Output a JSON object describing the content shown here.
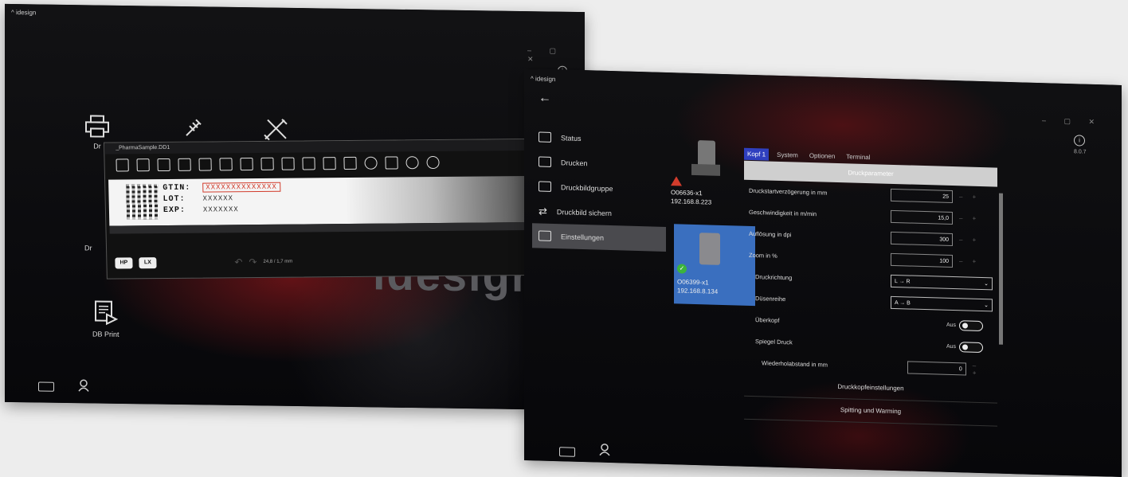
{
  "left_window": {
    "app_title": "idesign",
    "tiles": [
      {
        "label": "Dr",
        "icon": "printer-icon"
      },
      {
        "label": "",
        "icon": "plug-icon"
      },
      {
        "label": "",
        "icon": "tools-icon"
      },
      {
        "label": "Dr",
        "icon": "document-icon"
      },
      {
        "label": "DB Print",
        "icon": "db-print-icon"
      }
    ],
    "background_logo": "idesign",
    "editor": {
      "title": "_PharmaSample.DD1",
      "label_lines": [
        {
          "key": "GTIN:",
          "value": "XXXXXXXXXXXXXX"
        },
        {
          "key": "LOT:",
          "value": "XXXXXX"
        },
        {
          "key": "EXP:",
          "value": "XXXXXXX"
        }
      ],
      "badges": [
        "HP",
        "LX"
      ],
      "dimensions": "24,8 / 1,7 mm"
    }
  },
  "right_window": {
    "app_title": "idesign",
    "version": "8.0.7",
    "nav": [
      {
        "label": "Status",
        "icon": "monitor-icon",
        "active": false
      },
      {
        "label": "Drucken",
        "icon": "printer-icon",
        "active": false
      },
      {
        "label": "Druckbildgruppe",
        "icon": "print-group-icon",
        "active": false
      },
      {
        "label": "Druckbild sichern",
        "icon": "transfer-icon",
        "active": false
      },
      {
        "label": "Einstellungen",
        "icon": "settings-printer-icon",
        "active": true
      }
    ],
    "devices": [
      {
        "name": "O06636-x1",
        "ip": "192.168.8.223",
        "status": "warning"
      },
      {
        "name": "O06399-x1",
        "ip": "192.168.8.134",
        "status": "ok",
        "selected": true
      }
    ],
    "tabs": [
      "Kopf 1",
      "System",
      "Optionen",
      "Terminal"
    ],
    "section_header": "Druckparameter",
    "params": [
      {
        "label": "Druckstartverzögerung in mm",
        "type": "number",
        "value": "25"
      },
      {
        "label": "Geschwindigkeit in m/min",
        "type": "number",
        "value": "15,0"
      },
      {
        "label": "Auflösung in dpi",
        "type": "number",
        "value": "300"
      },
      {
        "label": "Zoom in %",
        "type": "number",
        "value": "100"
      },
      {
        "label": "Druckrichtung",
        "type": "select",
        "value": "L → R"
      },
      {
        "label": "Düsenreihe",
        "type": "select",
        "value": "A → B"
      },
      {
        "label": "Überkopf",
        "type": "toggle",
        "value": "Aus"
      },
      {
        "label": "Spiegel Druck",
        "type": "toggle",
        "value": "Aus"
      },
      {
        "label": "Wiederholabstand in mm",
        "type": "number",
        "value": "0"
      }
    ],
    "sections": [
      "Druckkopfeinstellungen",
      "Spitting und Warming"
    ],
    "accent": "#2f3fbf",
    "selected_card": "#3a6fbf",
    "warning": "#d23c2c",
    "ok": "#3cb43c"
  }
}
